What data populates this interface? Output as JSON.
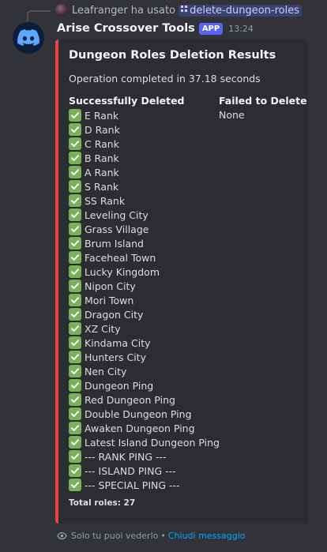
{
  "reply": {
    "user": "Leafranger",
    "verb": "ha usato",
    "command": "delete-dungeon-roles"
  },
  "message": {
    "username": "Arise Crossover Tools",
    "badge": "APP",
    "timestamp": "13:24"
  },
  "embed": {
    "accent_color": "#ed4245",
    "title": "Dungeon Roles Deletion Results",
    "description": "Operation completed in 37.18 seconds",
    "success_field": {
      "name": "Successfully Deleted",
      "icon": "check-mark-button-icon",
      "roles": [
        "E Rank",
        "D Rank",
        "C Rank",
        "B Rank",
        "A Rank",
        "S Rank",
        "SS Rank",
        "Leveling City",
        "Grass Village",
        "Brum Island",
        "Faceheal Town",
        "Lucky Kingdom",
        "Nipon City",
        "Mori Town",
        "Dragon City",
        "XZ City",
        "Kindama City",
        "Hunters City",
        "Nen City",
        "Dungeon Ping",
        "Red Dungeon Ping",
        "Double Dungeon Ping",
        "Awaken Dungeon Ping",
        "Latest Island Dungeon Ping",
        "--- RANK PING ---",
        "--- ISLAND PING ---",
        "--- SPECIAL PING ---"
      ]
    },
    "failed_field": {
      "name": "Failed to Delete",
      "value": "None"
    },
    "footer": "Total roles: 27"
  },
  "ephemeral": {
    "note": "Solo tu puoi vederlo",
    "separator": "•",
    "dismiss": "Chiudi messaggio"
  }
}
